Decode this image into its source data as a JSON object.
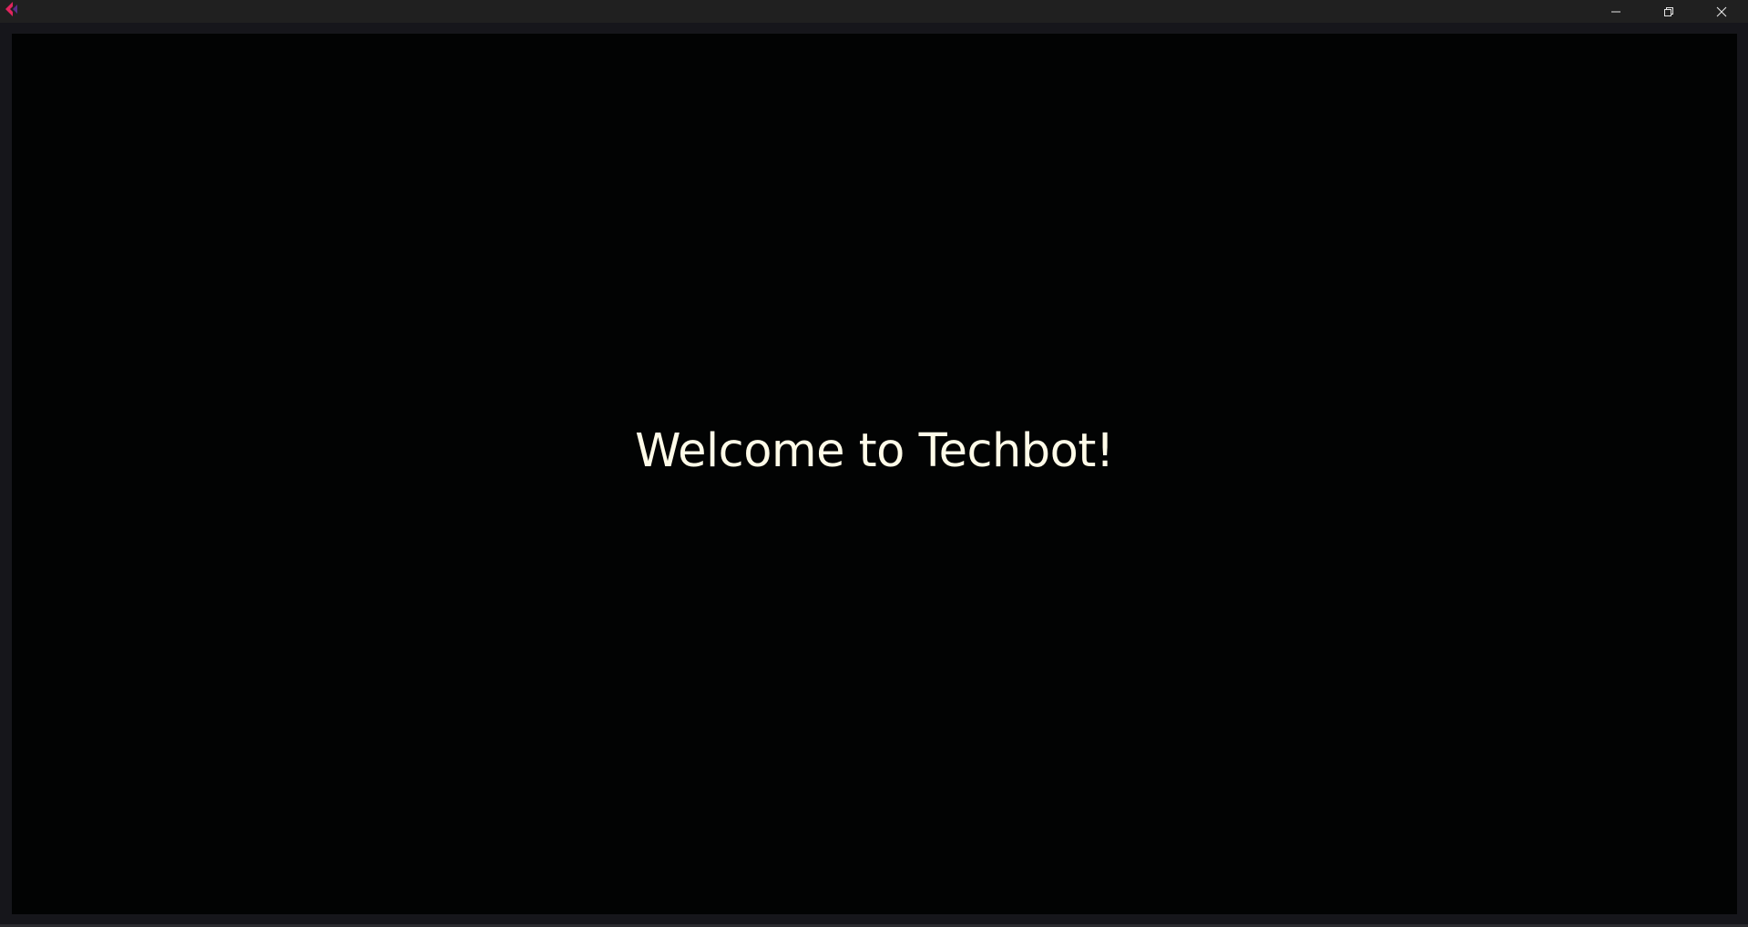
{
  "window": {
    "title": "",
    "app_icon": "pink-chevron-icon",
    "controls": {
      "minimize_icon": "minimize-icon",
      "restore_icon": "restore-icon",
      "close_icon": "close-icon"
    }
  },
  "main": {
    "welcome_text": "Welcome to Techbot!"
  },
  "colors": {
    "titlebar_bg": "#202020",
    "content_bg": "#020303",
    "frame_bg": "#16161b",
    "text": "#fffbe8",
    "icon_accent": "#e0245e"
  }
}
